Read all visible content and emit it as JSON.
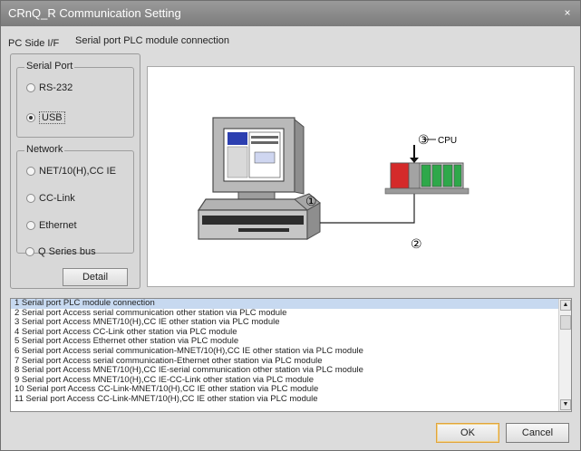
{
  "window": {
    "title": "CRnQ_R Communication Setting",
    "close_glyph": "×"
  },
  "header": {
    "pc_side_label": "PC Side I/F",
    "connection_label": "Serial port PLC module connection"
  },
  "serial_port": {
    "title": "Serial Port",
    "options": [
      {
        "label": "RS-232",
        "selected": false
      },
      {
        "label": "USB",
        "selected": true
      }
    ]
  },
  "network": {
    "title": "Network",
    "options": [
      {
        "label": "NET/10(H),CC IE",
        "selected": false
      },
      {
        "label": "CC-Link",
        "selected": false
      },
      {
        "label": "Ethernet",
        "selected": false
      }
    ]
  },
  "qbus": {
    "label": "Q Series bus",
    "selected": false
  },
  "detail_button": "Detail",
  "diagram": {
    "marker_1": "①",
    "marker_2": "②",
    "marker_3": "③",
    "cpu_label": "CPU"
  },
  "connection_list": {
    "items": [
      "1 Serial port PLC module connection",
      "2 Serial port Access serial communication other station via PLC module",
      "3 Serial port Access MNET/10(H),CC IE other station via PLC module",
      "4 Serial port Access CC-Link other station via PLC module",
      "5 Serial port Access Ethernet other station via PLC module",
      "6 Serial port Access serial communication-MNET/10(H),CC IE other station via PLC module",
      "7 Serial port Access serial communication-Ethernet other station via PLC module",
      "8 Serial port Access MNET/10(H),CC IE-serial communication other station via PLC module",
      "9 Serial port Access MNET/10(H),CC IE-CC-Link other station via PLC module",
      "10 Serial port Access CC-Link-MNET/10(H),CC IE other station via PLC module",
      "11 Serial port Access CC-Link-MNET/10(H),CC IE other station via PLC module"
    ],
    "selected_index": 0
  },
  "buttons": {
    "ok": "OK",
    "cancel": "Cancel"
  },
  "colors": {
    "title_bar": "#8a8a8a",
    "selection": "#c7d9f0",
    "default_button_border": "#e1a43c",
    "plc_red": "#d42a2a",
    "plc_green": "#2ea84a"
  }
}
